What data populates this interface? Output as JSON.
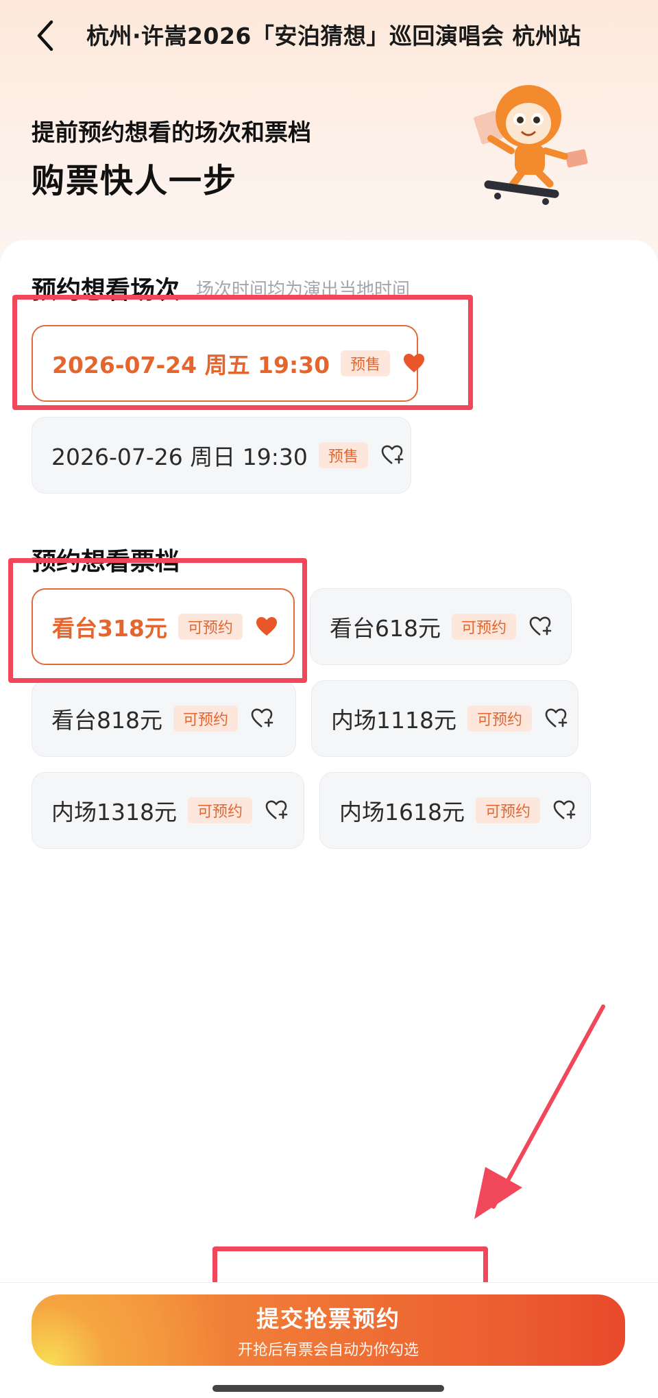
{
  "nav": {
    "title": "杭州·许嵩2026「安泊猜想」巡回演唱会 杭州站"
  },
  "hero": {
    "subtitle": "提前预约想看的场次和票档",
    "title": "购票快人一步"
  },
  "sessions": {
    "title": "预约想看场次",
    "note": "场次时间均为演出当地时间",
    "items": [
      {
        "label": "2026-07-24  周五 19:30",
        "badge": "预售",
        "selected": true
      },
      {
        "label": "2026-07-26 周日 19:30",
        "badge": "预售",
        "selected": false
      }
    ]
  },
  "tiers": {
    "title": "预约想看票档",
    "items": [
      {
        "label": "看台318元",
        "badge": "可预约",
        "selected": true
      },
      {
        "label": "看台618元",
        "badge": "可预约",
        "selected": false
      },
      {
        "label": "看台818元",
        "badge": "可预约",
        "selected": false
      },
      {
        "label": "内场1118元",
        "badge": "可预约",
        "selected": false
      },
      {
        "label": "内场1318元",
        "badge": "可预约",
        "selected": false
      },
      {
        "label": "内场1618元",
        "badge": "可预约",
        "selected": false
      }
    ]
  },
  "submit": {
    "label": "提交抢票预约",
    "sub": "开抢后有票会自动为你勾选"
  },
  "colors": {
    "accent": "#e4652e",
    "highlight_box": "#f0485a",
    "chip_bg": "#f5f6f8"
  },
  "icons": {
    "back": "chevron-left-icon",
    "selected_heart": "heart-filled-icon",
    "add_heart": "heart-plus-icon"
  }
}
